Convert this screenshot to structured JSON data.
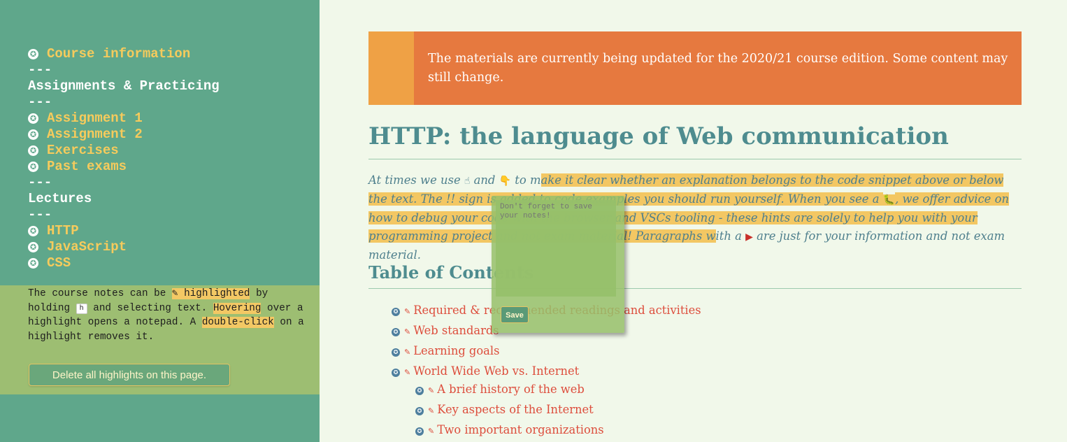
{
  "sidebar": {
    "course_info": "Course information",
    "sep": "---",
    "assignments_heading": "Assignments & Practicing",
    "assignments": [
      "Assignment 1",
      "Assignment 2",
      "Exercises",
      "Past exams"
    ],
    "lectures_heading": "Lectures",
    "lectures": [
      "HTTP",
      "JavaScript",
      "CSS"
    ],
    "icon": "star-circle-icon"
  },
  "highlight_help": {
    "t1": "The course notes can be ",
    "t2": "✎ highlighted",
    "t3": " by holding ",
    "key": "h",
    "t4": " and selecting text. ",
    "t5": "Hovering",
    "t6": " over a highlight opens a notepad. A ",
    "t7": "double-click",
    "t8": " on a highlight removes it.",
    "delete_button": "Delete all highlights on this page."
  },
  "banner": {
    "text": "The materials are currently being updated for the 2020/21 course edition. Some content may still change."
  },
  "page": {
    "title": "HTTP: the language of Web communication",
    "intro": {
      "p1": "At times we use ",
      "emoji_up": "☝",
      "p2": " and ",
      "emoji_down": "👇",
      "p3": " to m",
      "h1": "ake it clear whether an explanation belongs to the code snippet above or below the text. The ",
      "bang": "!!",
      "h2": " sign is added to code examples you should run yourself. When you see a ",
      "bug": "🐛",
      "h3": ", we offer advice on how to debug your code with the browser and VSCs tooling - these hints are solely to help you with your programming project and not exam material! Paragraphs w",
      "p4": "ith a ",
      "flag": "▶",
      "p5": " are just for your information and not exam material."
    },
    "toc_title": "Table of Contents",
    "toc": [
      "Required & recommended readings and activities",
      "Web standards",
      "Learning goals",
      "World Wide Web vs. Internet",
      "A brief history of the web",
      "Key aspects of the Internet",
      "Two important organizations"
    ]
  },
  "note": {
    "placeholder": "Don't forget to save your notes!",
    "save": "Save"
  }
}
